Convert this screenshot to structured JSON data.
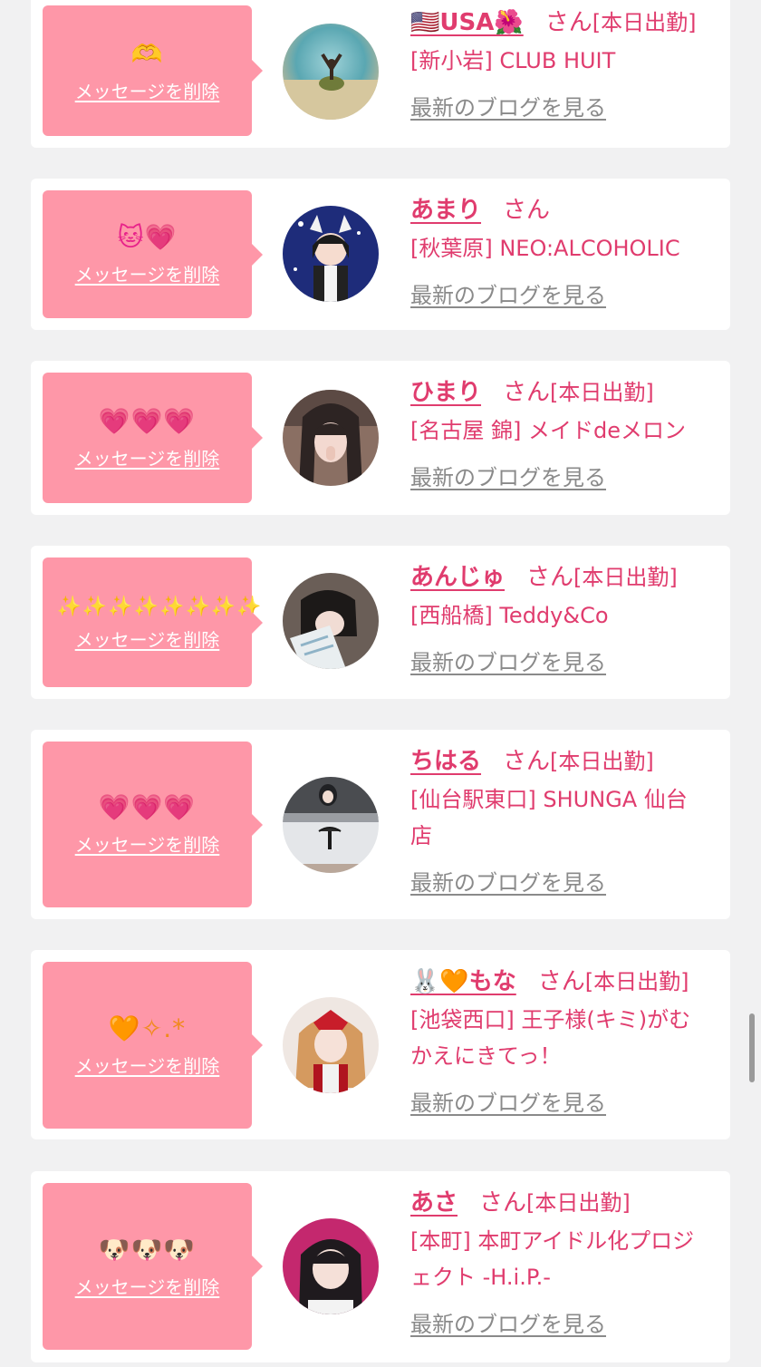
{
  "delete_label": "メッセージを削除",
  "blog_label": "最新のブログを見る",
  "honorific": "さん",
  "accent_color": "#e03c6e",
  "bubble_color": "#fe97a8",
  "cards": [
    {
      "emoji": "🫶",
      "name": "🇺🇸USA🌺",
      "status": "[本日出勤]",
      "shop": "[新小岩] CLUB HUIT"
    },
    {
      "emoji": "🐱💗",
      "name": "あまり",
      "status": "",
      "shop": "[秋葉原] NEO:ALCOHOLIC"
    },
    {
      "emoji": "💗💗💗",
      "name": "ひまり",
      "status": "[本日出勤]",
      "shop": "[名古屋 錦] メイドdeメロン"
    },
    {
      "emoji": "✨✨✨✨✨✨✨✨",
      "name": "あんじゅ",
      "status": "[本日出勤]",
      "shop": "[西船橋] Teddy&Co"
    },
    {
      "emoji": "💗💗💗",
      "name": "ちはる",
      "status": "[本日出勤]",
      "shop": "[仙台駅東口] SHUNGA 仙台店"
    },
    {
      "emoji": "🧡✧.*",
      "name": "🐰🧡もな",
      "status": "[本日出勤]",
      "shop": "[池袋西口] 王子様(キミ)がむかえにきてっ！"
    },
    {
      "emoji": "🐶🐶🐶",
      "name": "あさ",
      "status": "[本日出勤]",
      "shop": "[本町] 本町アイドル化プロジェクト -H.i.P.-"
    }
  ]
}
